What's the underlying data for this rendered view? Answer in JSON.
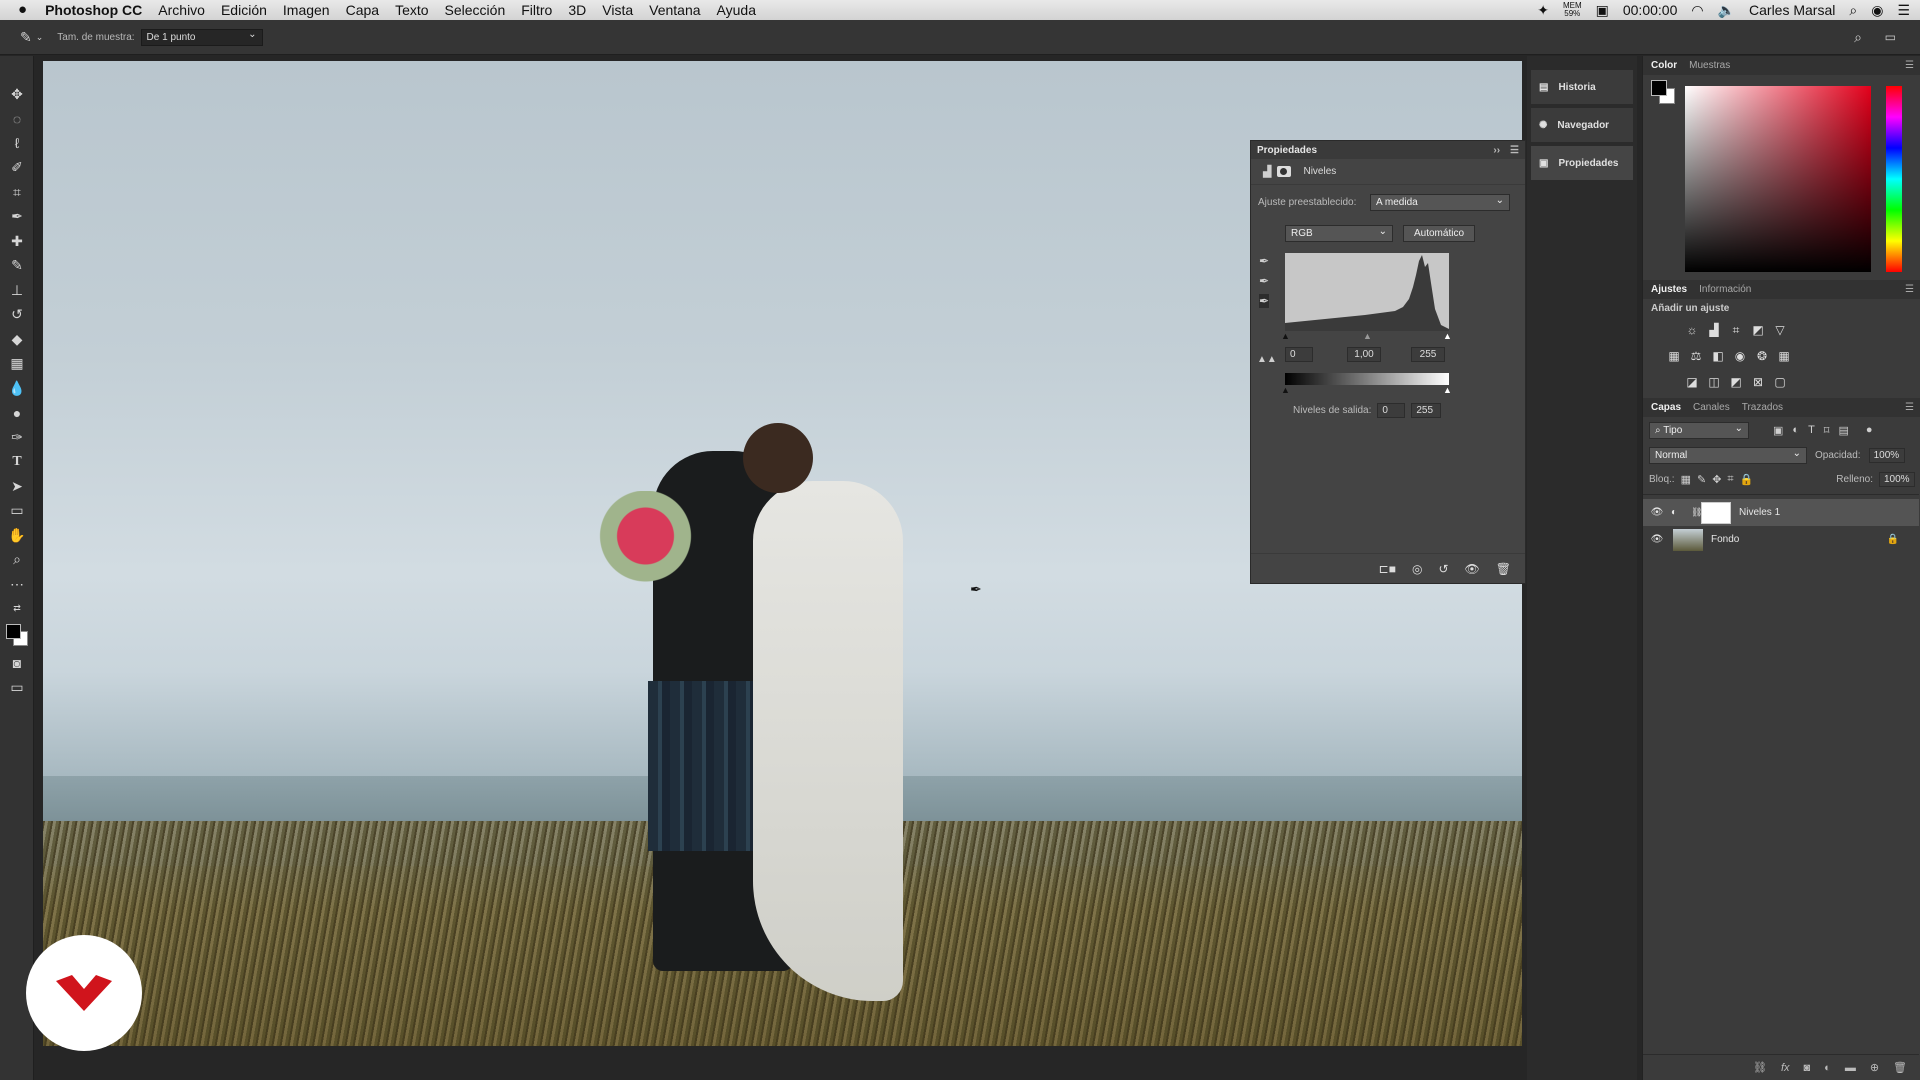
{
  "menubar": {
    "apple": "",
    "items": [
      "Photoshop CC",
      "Archivo",
      "Edición",
      "Imagen",
      "Capa",
      "Texto",
      "Selección",
      "Filtro",
      "3D",
      "Vista",
      "Ventana",
      "Ayuda"
    ],
    "status": {
      "mem_label": "MEM",
      "mem_value": "59%",
      "time": "00:00:00",
      "wifi": "wifi-icon",
      "volume": "volume-icon",
      "user": "Carles Marsal"
    }
  },
  "options": {
    "sample_label": "Tam. de muestra:",
    "sample_value": "De 1 punto"
  },
  "tools": [
    "move-icon",
    "lasso-ellipse-icon",
    "lasso-icon",
    "quick-select-icon",
    "crop-icon",
    "eyedropper-icon",
    "healing-icon",
    "brush-icon",
    "stamp-icon",
    "history-brush-icon",
    "eraser-icon",
    "gradient-icon",
    "blur-icon",
    "dodge-icon",
    "pen-icon",
    "type-icon",
    "path-select-icon",
    "rectangle-icon",
    "hand-icon",
    "zoom-icon",
    "more-icon"
  ],
  "dock": {
    "items": [
      {
        "icon": "history-icon",
        "label": "Historia"
      },
      {
        "icon": "navigator-icon",
        "label": "Navegador"
      },
      {
        "icon": "properties-icon",
        "label": "Propiedades"
      }
    ]
  },
  "properties": {
    "title": "Propiedades",
    "layer_type": "Niveles",
    "preset_label": "Ajuste preestablecido:",
    "preset_value": "A medida",
    "channel": "RGB",
    "auto_label": "Automático",
    "input_black": "0",
    "input_gamma": "1,00",
    "input_white": "255",
    "output_label": "Niveles de salida:",
    "output_black": "0",
    "output_white": "255"
  },
  "color_panel": {
    "tabs": [
      "Color",
      "Muestras"
    ],
    "foreground": "#000000",
    "background": "#ffffff"
  },
  "adjustments_panel": {
    "tabs": [
      "Ajustes",
      "Información"
    ],
    "subtitle": "Añadir un ajuste"
  },
  "layers_panel": {
    "tabs": [
      "Capas",
      "Canales",
      "Trazados"
    ],
    "filter": "Tipo",
    "blend_mode": "Normal",
    "opacity_label": "Opacidad:",
    "opacity_value": "100%",
    "lock_label": "Bloq.:",
    "fill_label": "Relleno:",
    "fill_value": "100%",
    "layers": [
      {
        "name": "Niveles 1"
      },
      {
        "name": "Fondo"
      }
    ]
  }
}
